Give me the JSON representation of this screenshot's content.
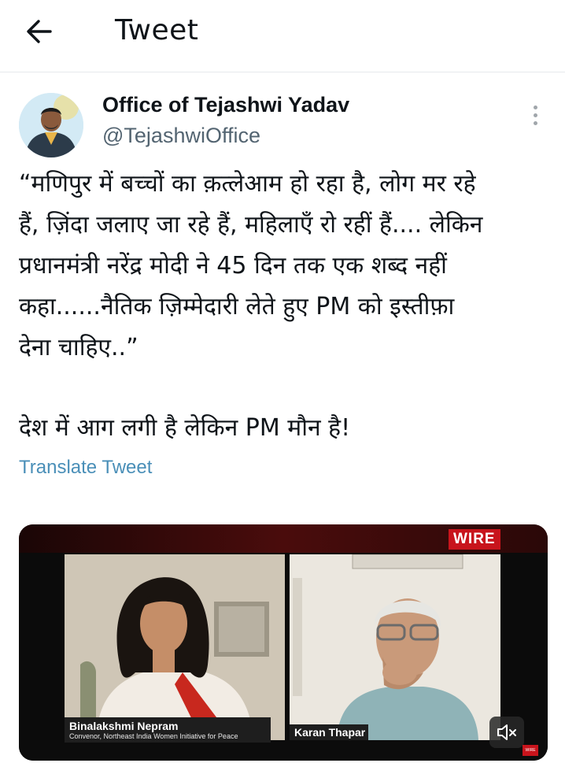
{
  "header": {
    "title": "Tweet",
    "back_icon": "arrow-left-icon"
  },
  "author": {
    "name": "Office of Tejashwi Yadav",
    "handle": "@TejashwiOffice",
    "more_icon": "more-vertical-icon"
  },
  "tweet": {
    "paragraph_lines": [
      "“मणिपुर में बच्चों का क़त्लेआम हो रहा है, लोग मर रहे",
      "हैं, ज़िंदा जलाए जा रहे हैं, महिलाएँ रो रहीं हैं.... लेकिन",
      "प्रधानमंत्री नरेंद्र मोदी ने 45 दिन तक एक शब्द नहीं",
      "कहा......नैतिक ज़िम्मेदारी लेते हुए PM को इस्तीफ़ा",
      "देना चाहिए..”"
    ],
    "second_paragraph": "देश में आग लगी है लेकिन PM मौन है!",
    "translate_label": "Translate Tweet"
  },
  "video": {
    "logo": "WIRE",
    "guest_name": "Binalakshmi Nepram",
    "guest_title": "Convenor, Northeast India Women Initiative for Peace",
    "host_name": "Karan Thapar",
    "mute_icon": "speaker-muted-icon",
    "corner_logo": "WIRE"
  },
  "colors": {
    "link": "#4a8fb8",
    "handle": "#536471",
    "wire_red": "#c8141c"
  }
}
